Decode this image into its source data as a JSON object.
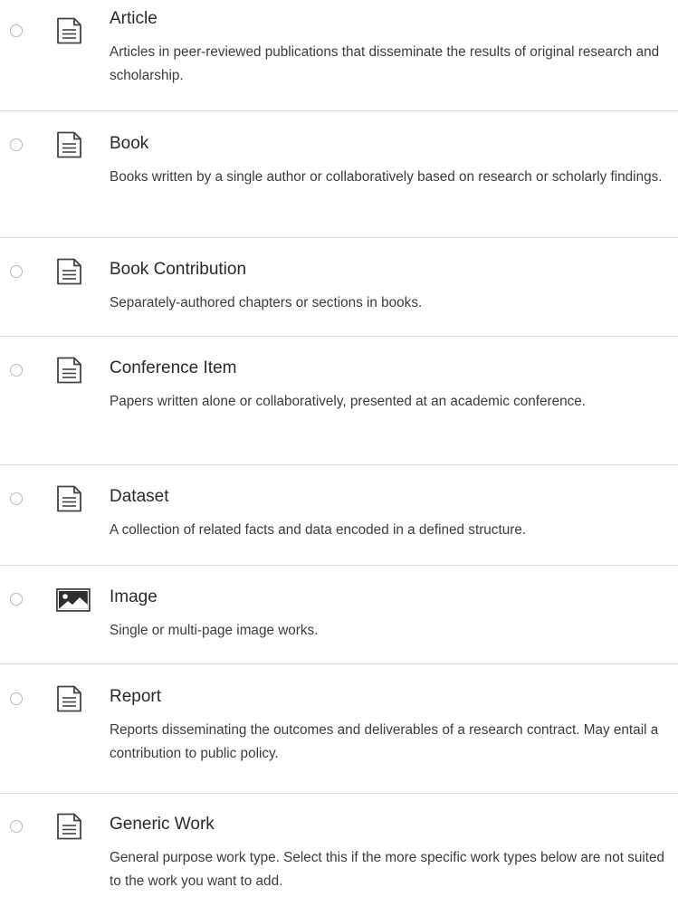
{
  "work_types": [
    {
      "title": "Article",
      "icon": "document-icon",
      "description": "Articles in peer-reviewed publications that disseminate the results of original research and scholarship."
    },
    {
      "title": "Book",
      "icon": "document-icon",
      "description": "Books written by a single author or collaboratively based on research or scholarly findings."
    },
    {
      "title": "Book Contribution",
      "icon": "document-icon",
      "description": "Separately-authored chapters or sections in books."
    },
    {
      "title": "Conference Item",
      "icon": "document-icon",
      "description": "Papers written alone or collaboratively, presented at an academic conference."
    },
    {
      "title": "Dataset",
      "icon": "document-icon",
      "description": "A collection of related facts and data encoded in a defined structure."
    },
    {
      "title": "Image",
      "icon": "image-icon",
      "description": "Single or multi-page image works."
    },
    {
      "title": "Report",
      "icon": "document-icon",
      "description": "Reports disseminating the outcomes and deliverables of a research contract. May entail a contribution to public policy."
    },
    {
      "title": "Generic Work",
      "icon": "document-icon",
      "description": "General purpose work type. Select this if the more specific work types below are not suited to the work you want to add."
    }
  ]
}
